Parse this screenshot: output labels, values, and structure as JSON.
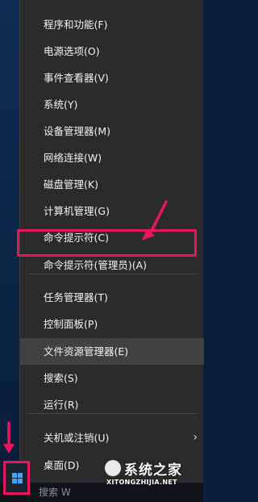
{
  "menu": {
    "items": [
      {
        "label": "程序和功能(F)"
      },
      {
        "label": "电源选项(O)"
      },
      {
        "label": "事件查看器(V)"
      },
      {
        "label": "系统(Y)"
      },
      {
        "label": "设备管理器(M)"
      },
      {
        "label": "网络连接(W)"
      },
      {
        "label": "磁盘管理(K)"
      },
      {
        "label": "计算机管理(G)"
      },
      {
        "label": "命令提示符(C)"
      },
      {
        "label": "命令提示符(管理员)(A)"
      },
      {
        "label": "任务管理器(T)"
      },
      {
        "label": "控制面板(P)"
      },
      {
        "label": "文件资源管理器(E)"
      },
      {
        "label": "搜索(S)"
      },
      {
        "label": "运行(R)"
      },
      {
        "label": "关机或注销(U)",
        "submenu_indicator": "›"
      },
      {
        "label": "桌面(D)"
      }
    ]
  },
  "taskbar": {
    "search_hint": "搜索 W"
  },
  "watermark": {
    "brand": "系统之家",
    "url": "XITONGZHIJIA.NET"
  },
  "icons": {
    "start": "windows-logo-icon",
    "annotation_arrow": "pink-arrow-icon",
    "submenu": "chevron-right-icon"
  },
  "colors": {
    "menu_bg": "#2b2b2b",
    "menu_hover": "#414141",
    "annotation": "#e8175d",
    "win_logo": "#3ea6ff"
  }
}
